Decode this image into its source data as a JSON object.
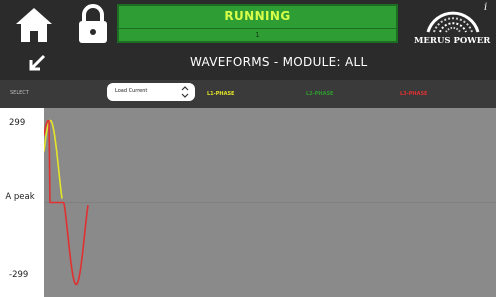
{
  "header": {
    "status": "RUNNING",
    "status_sub": "1",
    "brand": "MERUS POWER",
    "info": "i",
    "home_icon": "home-icon",
    "lock_icon": "lock-icon",
    "colors": {
      "status_bg": "#2e9d33",
      "status_text": "#d7ff4a"
    }
  },
  "title": {
    "text": "WAVEFORMS - MODULE: ALL",
    "back_icon": "back-arrow-icon"
  },
  "select_bar": {
    "label": "SELECT",
    "dropdown_value": "Load Current",
    "phases": [
      {
        "label": "L1-PHASE",
        "color": "#e4e429"
      },
      {
        "label": "L2-PHASE",
        "color": "#2f9a2f"
      },
      {
        "label": "L3-PHASE",
        "color": "#e03030"
      }
    ]
  },
  "chart_data": {
    "type": "line",
    "ylabel": "A peak",
    "ylim": [
      -299,
      299
    ],
    "y_ticks": [
      "299",
      "-299"
    ],
    "series": [
      {
        "name": "L1-PHASE",
        "color": "#e4e429"
      },
      {
        "name": "L2-PHASE",
        "color": "#2f9a2f"
      },
      {
        "name": "L3-PHASE",
        "color": "#e03030"
      }
    ]
  }
}
